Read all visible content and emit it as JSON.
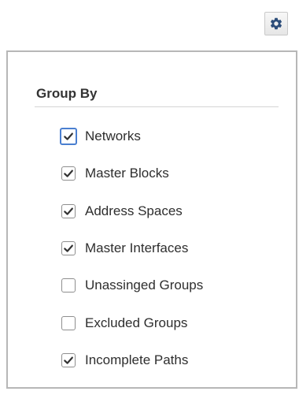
{
  "toolbar": {
    "settings_icon": "gear-icon"
  },
  "group_by": {
    "title": "Group By",
    "options": [
      {
        "label": "Networks",
        "checked": true,
        "focused": true
      },
      {
        "label": "Master Blocks",
        "checked": true
      },
      {
        "label": "Address Spaces",
        "checked": true
      },
      {
        "label": "Master Interfaces",
        "checked": true
      },
      {
        "label": "Unassinged Groups",
        "checked": false
      },
      {
        "label": "Excluded Groups",
        "checked": false
      },
      {
        "label": "Incomplete Paths",
        "checked": true
      }
    ]
  },
  "colors": {
    "icon": "#2c4d7a",
    "focus_ring": "#4a7fd0",
    "panel_border": "#b7b7b7",
    "checkmark": "#333333"
  }
}
